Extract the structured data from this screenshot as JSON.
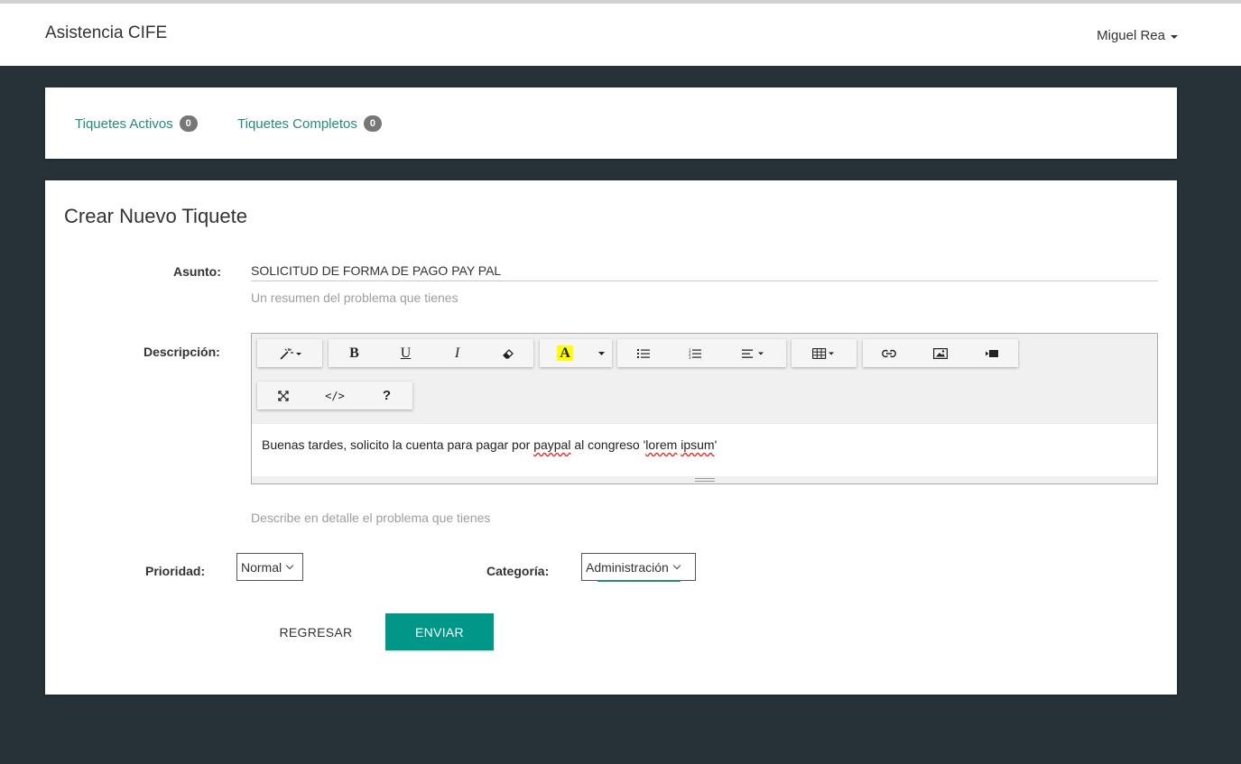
{
  "header": {
    "brand": "Asistencia CIFE",
    "user_name": "Miguel Rea"
  },
  "nav": {
    "active_label": "Tiquetes Activos",
    "active_count": "0",
    "completed_label": "Tiquetes Completos",
    "completed_count": "0",
    "link_color": "#26897c"
  },
  "form": {
    "title": "Crear Nuevo Tiquete",
    "subject_label": "Asunto:",
    "subject_value": "SOLICITUD DE FORMA DE PAGO PAY PAL",
    "subject_help": "Un resumen del problema que tienes",
    "description_label": "Descripción:",
    "description_text_1": "Buenas tardes, solicito la cuenta para pagar por ",
    "description_word_paypal": "paypal",
    "description_text_2": " al congreso '",
    "description_word_lorem": "lorem",
    "description_text_3": " ",
    "description_word_ipsum": "ipsum",
    "description_text_4": "'",
    "description_help": "Describe en detalle el problema que tienes",
    "priority_label": "Prioridad:",
    "priority_value": "Normal",
    "category_label": "Categoría:",
    "category_value": "Administración",
    "back_button": "REGRESAR",
    "send_button": "ENVIAR",
    "accent_color": "#009688"
  },
  "toolbar": {
    "bold": "B",
    "underline": "U",
    "italic": "I",
    "forecolor": "A",
    "code": "</>",
    "help": "?",
    "icons": [
      "magic-icon",
      "bold-icon",
      "underline-icon",
      "italic-icon",
      "eraser-icon",
      "font-color-icon",
      "unordered-list-icon",
      "ordered-list-icon",
      "align-icon",
      "table-icon",
      "link-icon",
      "picture-icon",
      "video-icon",
      "fullscreen-icon",
      "code-view-icon",
      "help-icon"
    ]
  }
}
